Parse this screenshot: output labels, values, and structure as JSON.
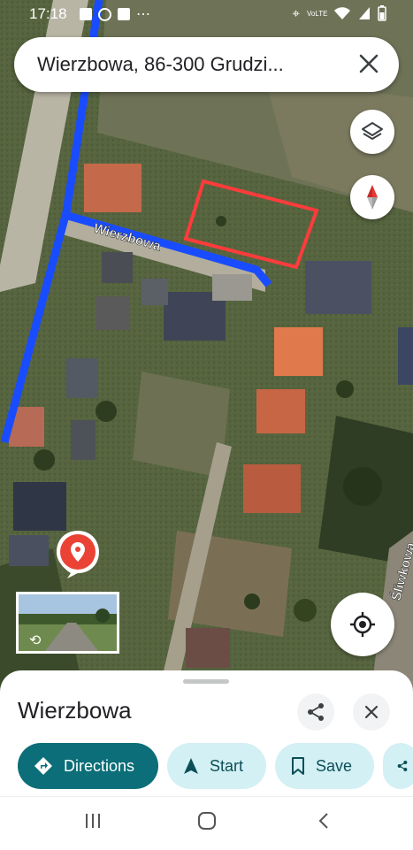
{
  "status_bar": {
    "time": "17:18",
    "network_label": "VoLTE",
    "left_icons": [
      "gallery-icon",
      "whatsapp-icon",
      "notification-icon",
      "more-dots-icon"
    ],
    "right_icons": [
      "location-icon",
      "signal-icon",
      "wifi-icon",
      "battery-icon"
    ]
  },
  "search": {
    "query": "Wierzbowa, 86-300 Grudzi..."
  },
  "map": {
    "street_labels": {
      "wierzbowa": "Wierzbowa",
      "sliwkowa": "Śliwkowa"
    },
    "colors": {
      "route": "#1a4cff",
      "plot_outline": "#ff3b3b",
      "pin": "#ea4335"
    }
  },
  "map_controls": [
    "layers-icon",
    "compass-icon",
    "my-location-icon"
  ],
  "street_view": {
    "label": "street-view-thumbnail"
  },
  "place_sheet": {
    "title": "Wierzbowa",
    "actions": {
      "directions": "Directions",
      "start": "Start",
      "save": "Save"
    },
    "accent": "#0b6e78"
  },
  "nav_bar": [
    "recent-apps-icon",
    "home-icon",
    "back-icon"
  ]
}
